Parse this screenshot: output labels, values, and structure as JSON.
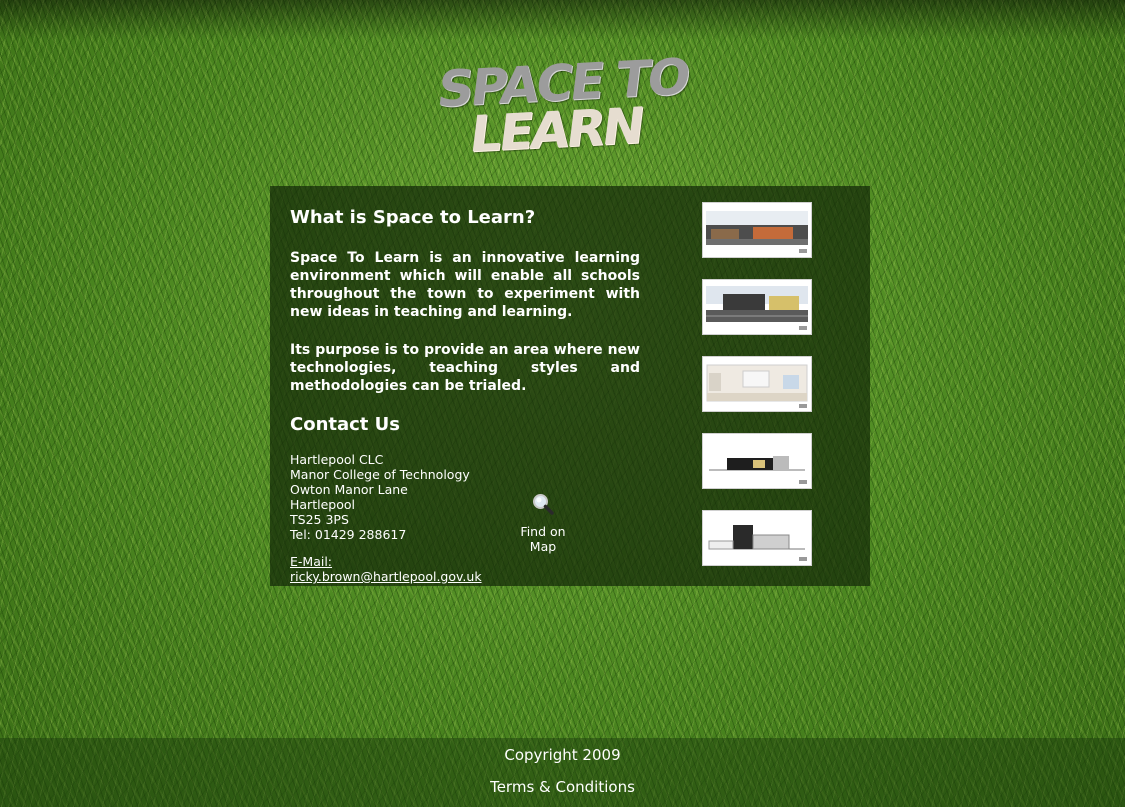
{
  "logo": {
    "line1": "SPACE TO",
    "line2": "LEARN"
  },
  "about": {
    "heading": "What is Space to Learn?",
    "paragraph1": "Space To Learn is an innovative learning environment which will enable all schools throughout the town to experiment with new ideas in teaching and learning.",
    "paragraph2": "Its purpose is to provide an area where new technologies, teaching styles and methodologies can be trialed."
  },
  "contact": {
    "heading": "Contact Us",
    "address_lines": [
      "Hartlepool CLC",
      "Manor College of Technology",
      "Owton Manor Lane",
      "Hartlepool",
      "TS25 3PS",
      "Tel: 01429 288617"
    ],
    "email_label": "E-Mail:",
    "email": "ricky.brown@hartlepool.gov.uk",
    "map_icon": "magnifier-icon",
    "map_label": "Find on Map"
  },
  "thumbnails": [
    {
      "name": "thumbnail-exterior-1",
      "icon": "building-exterior-photo"
    },
    {
      "name": "thumbnail-exterior-2",
      "icon": "building-exterior-photo"
    },
    {
      "name": "thumbnail-interior",
      "icon": "building-interior-render"
    },
    {
      "name": "thumbnail-elevation-1",
      "icon": "elevation-drawing"
    },
    {
      "name": "thumbnail-elevation-2",
      "icon": "elevation-drawing"
    }
  ],
  "footer": {
    "copyright": "Copyright 2009",
    "terms": "Terms & Conditions"
  },
  "colors": {
    "text": "#ffffff",
    "panel": "#142808",
    "grass": "#4f8a22"
  }
}
